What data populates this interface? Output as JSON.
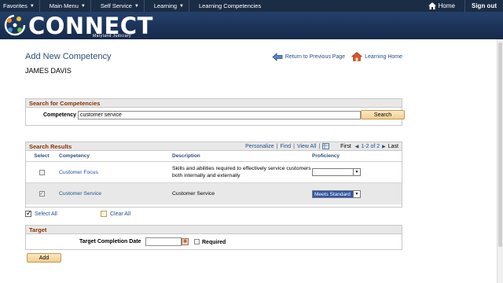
{
  "nav": {
    "favorites": "Favorites",
    "main_menu": "Main Menu",
    "breadcrumb": [
      "Self Service",
      "Learning",
      "Learning Competencies"
    ],
    "home": "Home",
    "sign_out": "Sign out"
  },
  "brand": {
    "title": "CONNECT",
    "subtitle": "Maryland Judiciary"
  },
  "page": {
    "title": "Add New Competency",
    "user_name": "JAMES DAVIS",
    "return_link": "Return to Previous Page",
    "learning_home_link": "Learning Home"
  },
  "search": {
    "header": "Search for Competencies",
    "label": "Competency",
    "value": "customer service",
    "button": "Search"
  },
  "results": {
    "header": "Search Results",
    "personalize": "Personalize",
    "find": "Find",
    "view_all": "View All",
    "first": "First",
    "range": "1-2 of 2",
    "last": "Last",
    "columns": {
      "select": "Select",
      "competency": "Competency",
      "description": "Description",
      "proficiency": "Proficiency"
    },
    "rows": [
      {
        "competency": "Customer Focus",
        "description": "Skills and abilities required to effectively service customers both internally and externally",
        "proficiency": "",
        "selected": false
      },
      {
        "competency": "Customer Service",
        "description": "Customer Service",
        "proficiency": "Meets Standard",
        "selected": true
      }
    ]
  },
  "select_all": "Select All",
  "clear_all": "Clear All",
  "target": {
    "header": "Target",
    "date_label": "Target Completion Date",
    "required_label": "Required"
  },
  "add_button": "Add",
  "colors": {
    "nav_bg": "#1b2c45",
    "brand_bg": "#24406a",
    "link": "#1e4f8e",
    "section_header_text": "#8a3300",
    "button_bg": "#f2cf8f"
  }
}
